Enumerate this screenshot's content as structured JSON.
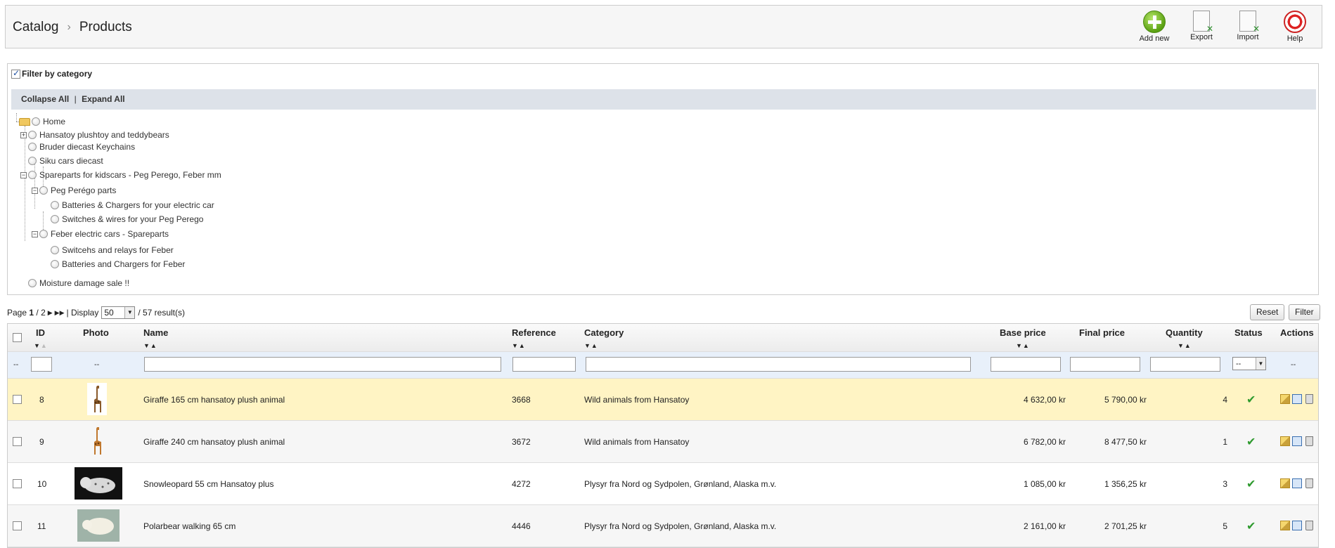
{
  "breadcrumb": {
    "parent": "Catalog",
    "current": "Products"
  },
  "toolbar": {
    "add_new": "Add new",
    "export": "Export",
    "import": "Import",
    "help": "Help"
  },
  "category_filter": {
    "label": "Filter by category",
    "checked": true,
    "collapse_all": "Collapse All",
    "separator": "|",
    "expand_all": "Expand All",
    "tree": [
      {
        "label": "Home"
      },
      {
        "label": "Hansatoy plushtoy and teddybears"
      },
      {
        "label": "Bruder diecast Keychains"
      },
      {
        "label": "Siku cars diecast"
      },
      {
        "label": "Spareparts for kidscars - Peg Perego, Feber mm"
      },
      {
        "label": "Peg Perégo parts"
      },
      {
        "label": "Batteries & Chargers for your electric car"
      },
      {
        "label": "Switches & wires for your Peg Perego"
      },
      {
        "label": "Feber electric cars - Spareparts"
      },
      {
        "label": "Switcehs and relays for Feber"
      },
      {
        "label": "Batteries and Chargers for Feber"
      },
      {
        "label": "Moisture damage sale !!"
      }
    ]
  },
  "pagination": {
    "page_label": "Page",
    "current_page": "1",
    "total_pages": "/ 2",
    "display_label": "| Display",
    "per_page": "50",
    "results": "/ 57 result(s)"
  },
  "buttons": {
    "reset": "Reset",
    "filter": "Filter"
  },
  "table": {
    "headers": {
      "id": "ID",
      "photo": "Photo",
      "name": "Name",
      "reference": "Reference",
      "category": "Category",
      "base_price": "Base price",
      "final_price": "Final price",
      "quantity": "Quantity",
      "status": "Status",
      "actions": "Actions"
    },
    "filter_row": {
      "dash": "--",
      "photo_dash": "--",
      "status_value": "--",
      "actions_dash": "--"
    },
    "rows": [
      {
        "id": "8",
        "name": "Giraffe 165 cm hansatoy plush animal",
        "reference": "3668",
        "category": "Wild animals from Hansatoy",
        "base_price": "4 632,00 kr",
        "final_price": "5 790,00 kr",
        "quantity": "4",
        "status": "✔"
      },
      {
        "id": "9",
        "name": "Giraffe 240 cm hansatoy plush animal",
        "reference": "3672",
        "category": "Wild animals from Hansatoy",
        "base_price": "6 782,00 kr",
        "final_price": "8 477,50 kr",
        "quantity": "1",
        "status": "✔"
      },
      {
        "id": "10",
        "name": "Snowleopard 55 cm Hansatoy plus",
        "reference": "4272",
        "category": "Plysyr fra Nord og Sydpolen, Grønland, Alaska m.v.",
        "base_price": "1 085,00 kr",
        "final_price": "1 356,25 kr",
        "quantity": "3",
        "status": "✔"
      },
      {
        "id": "11",
        "name": "Polarbear walking 65 cm",
        "reference": "4446",
        "category": "Plysyr fra Nord og Sydpolen, Grønland, Alaska m.v.",
        "base_price": "2 161,00 kr",
        "final_price": "2 701,25 kr",
        "quantity": "5",
        "status": "✔"
      }
    ]
  }
}
